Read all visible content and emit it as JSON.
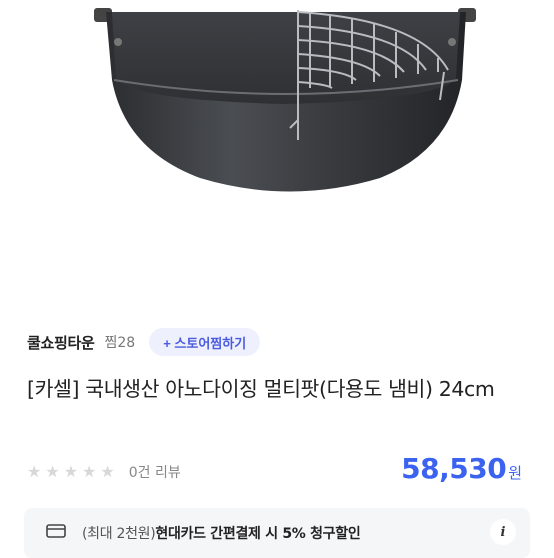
{
  "product_image": {
    "icon": "frying-pot-with-rack-image"
  },
  "store": {
    "name": "쿨쇼핑타운",
    "zzim": "찜28",
    "follow_label": "+ 스토어찜하기"
  },
  "product": {
    "title": "[카셀] 국내생산 아노다이징 멀티팟(다용도 냄비) 24cm"
  },
  "rating": {
    "stars_filled": 0,
    "stars_total": 5,
    "review_text": "0건 리뷰"
  },
  "price": {
    "value": "58,530",
    "unit": "원"
  },
  "benefit": {
    "icon": "credit-card-icon",
    "prefix": "(최대 2천원)",
    "text": "현대카드 간편결제 시 5% 청구할인",
    "info_label": "i"
  },
  "colors": {
    "accent": "#3c63f0",
    "follow_bg": "#eef0fd",
    "benefit_bg": "#f5f6f8"
  }
}
